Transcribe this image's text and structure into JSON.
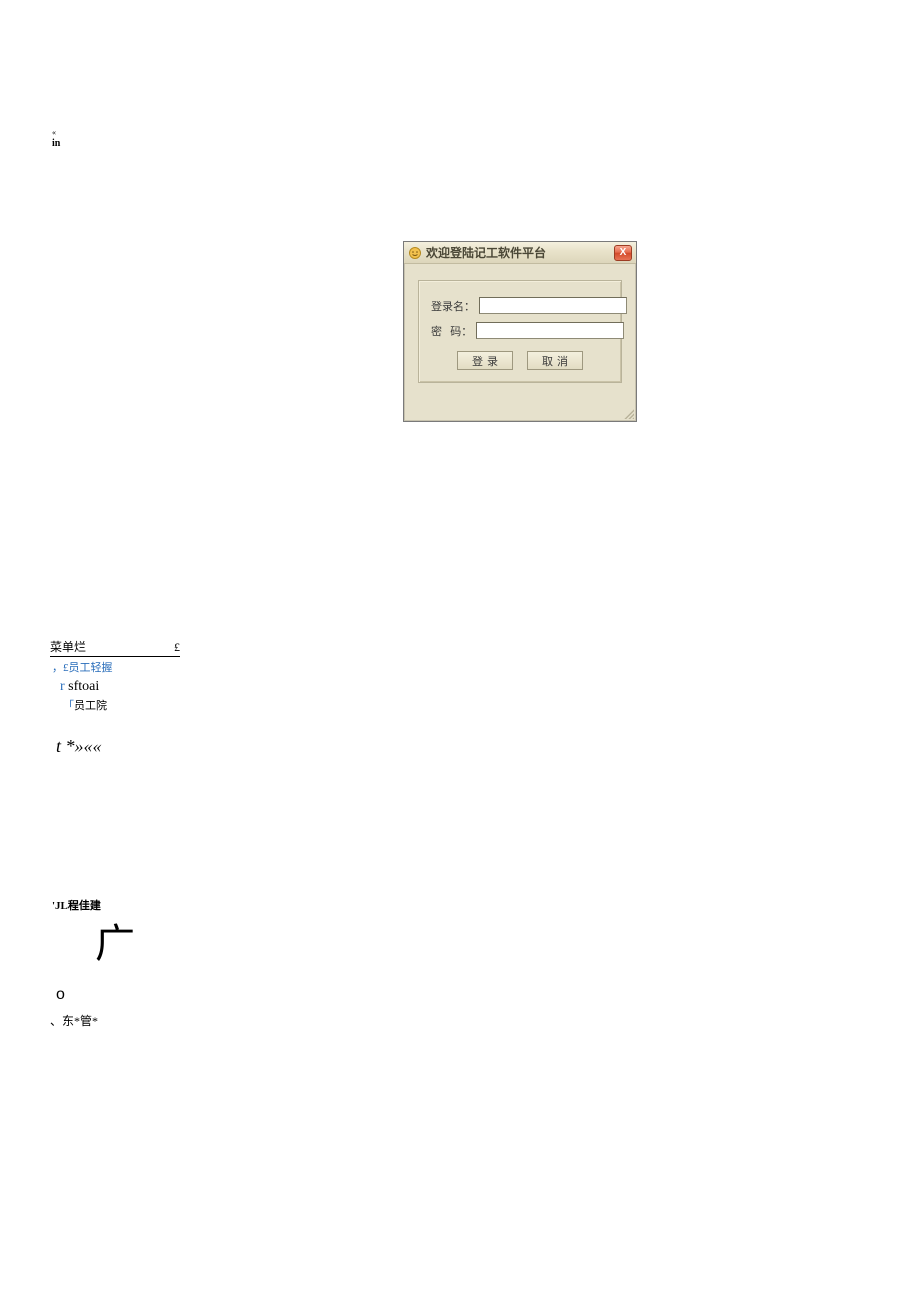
{
  "fragments": {
    "top_a": "«",
    "top_b": "in",
    "menu_header_left": "菜单烂",
    "menu_header_right": "£",
    "staff_line": "，£员工轻握",
    "sftoai_lead": "r ",
    "sftoai": "sftoai",
    "staffyuan_lead": "「",
    "staffyuan": "员工院",
    "t_line": "t *»««",
    "jl": "'JL程佳建",
    "guang": "广",
    "circle": "o",
    "dong": "、东*管*"
  },
  "login": {
    "title": "欢迎登陆记工软件平台",
    "close_glyph": "X",
    "username_label": "登录名：",
    "password_label": "密   码：",
    "username_value": "",
    "password_value": "",
    "login_btn": "登录",
    "cancel_btn": "取消"
  }
}
